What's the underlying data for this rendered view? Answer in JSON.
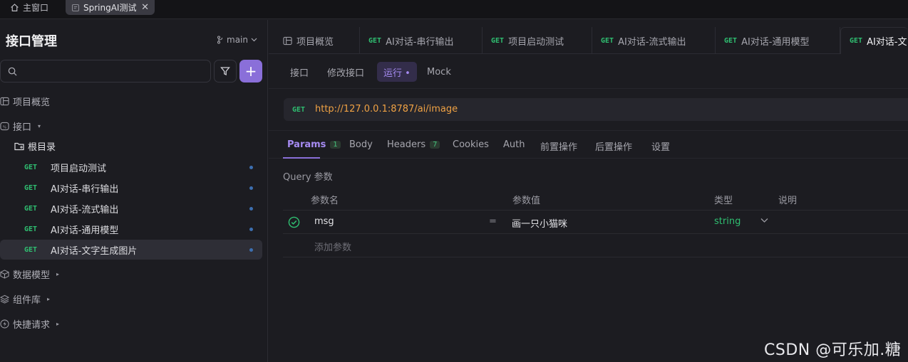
{
  "window_tabs": {
    "home_label": "主窗口",
    "active_label": "SpringAI测试",
    "close_glyph": "✕"
  },
  "sidebar": {
    "title": "接口管理",
    "branch": "main",
    "search": {
      "placeholder": ""
    },
    "add_glyph": "+",
    "nav": [
      {
        "label": "项目概览",
        "icon": "overview-icon"
      },
      {
        "label": "接口",
        "icon": "api-icon"
      }
    ],
    "root_dir": "根目录",
    "apis": [
      {
        "method": "GET",
        "name": "项目启动测试"
      },
      {
        "method": "GET",
        "name": "AI对话-串行输出"
      },
      {
        "method": "GET",
        "name": "AI对话-流式输出"
      },
      {
        "method": "GET",
        "name": "AI对话-通用模型"
      },
      {
        "method": "GET",
        "name": "AI对话-文字生成图片",
        "selected": true
      }
    ],
    "sections": [
      {
        "label": "数据模型",
        "icon": "cube-icon"
      },
      {
        "label": "组件库",
        "icon": "layers-icon"
      },
      {
        "label": "快捷请求",
        "icon": "bolt-icon"
      }
    ],
    "caret_glyph": "▸"
  },
  "request_tabs": [
    {
      "method": "",
      "label": "项目概览"
    },
    {
      "method": "GET",
      "label": "AI对话-串行输出"
    },
    {
      "method": "GET",
      "label": "项目启动测试"
    },
    {
      "method": "GET",
      "label": "AI对话-流式输出"
    },
    {
      "method": "GET",
      "label": "AI对话-通用模型"
    },
    {
      "method": "GET",
      "label": "AI对话-文"
    }
  ],
  "sub_tabs": [
    "接口",
    "修改接口",
    "运行 •",
    "Mock"
  ],
  "url_bar": {
    "method": "GET",
    "url": "http://127.0.0.1:8787/ai/image"
  },
  "param_tabs": [
    {
      "label": "Params",
      "count": "1"
    },
    {
      "label": "Body",
      "count": ""
    },
    {
      "label": "Headers",
      "count": "7"
    },
    {
      "label": "Cookies",
      "count": ""
    },
    {
      "label": "Auth",
      "count": ""
    },
    {
      "label": "前置操作",
      "count": ""
    },
    {
      "label": "后置操作",
      "count": ""
    },
    {
      "label": "设置",
      "count": ""
    }
  ],
  "query": {
    "label": "Query 参数",
    "headers": [
      "参数名",
      "参数值",
      "类型",
      "说明"
    ],
    "rows": [
      {
        "name": "msg",
        "eq": "=",
        "value": "画一只小猫咪",
        "type": "string"
      }
    ],
    "add_placeholder": "添加参数"
  },
  "watermark": "CSDN @可乐加.糖",
  "colors": {
    "accent": "#8a6fd9",
    "get_method": "#2fbf71",
    "url": "#f0a244"
  }
}
